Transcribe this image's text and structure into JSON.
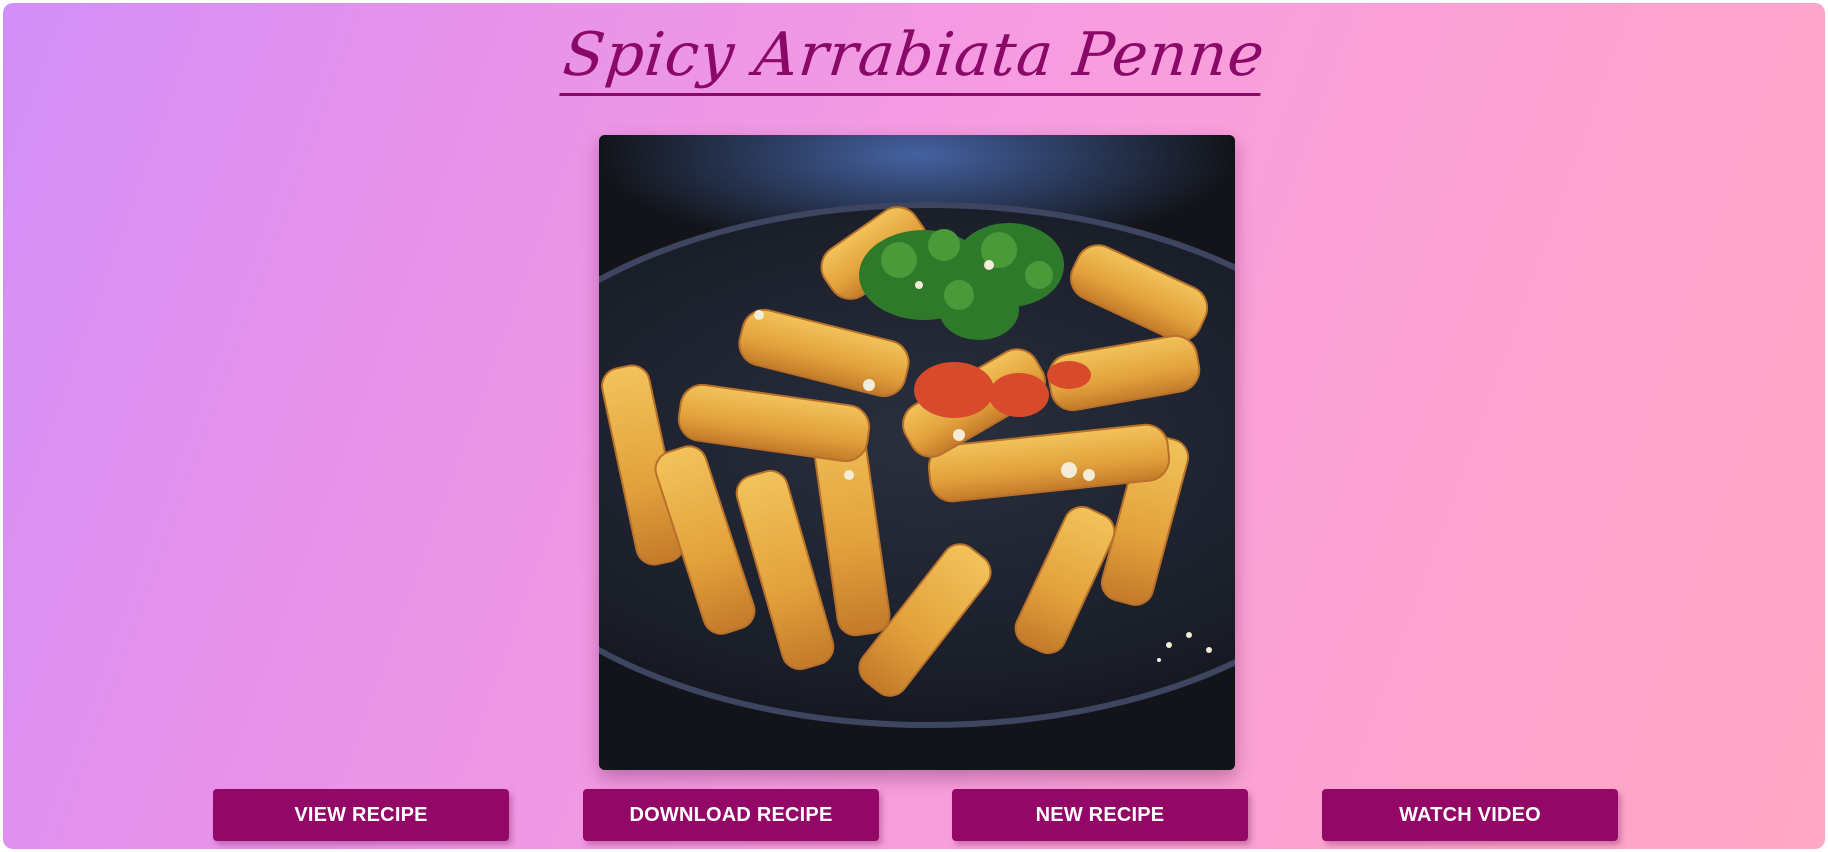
{
  "recipe": {
    "title": "Spicy Arrabiata Penne",
    "image_alt": "Spicy Arrabiata Penne"
  },
  "actions": {
    "view_recipe": "VIEW RECIPE",
    "download_recipe": "DOWNLOAD RECIPE",
    "new_recipe": "NEW RECIPE",
    "watch_video": "WATCH VIDEO"
  },
  "colors": {
    "accent": "#930866",
    "title": "#8a0868",
    "background_start": "#d28ff8",
    "background_end": "#ffa7c3"
  }
}
